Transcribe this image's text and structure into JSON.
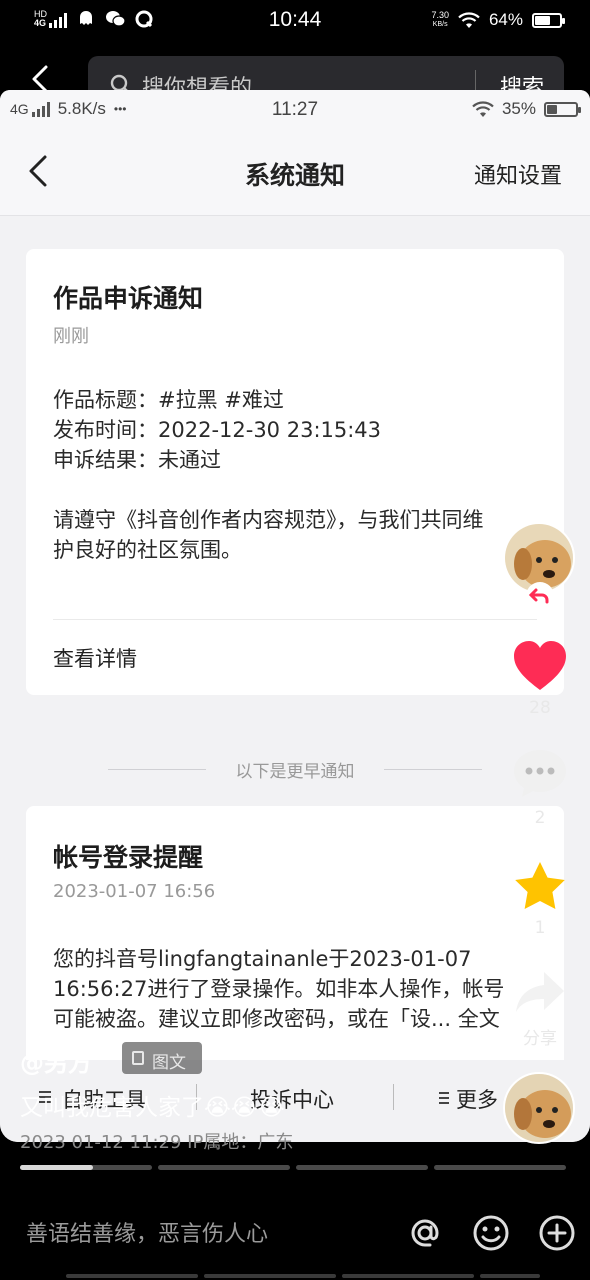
{
  "outer_status": {
    "network": "4G",
    "network_sup": "HD",
    "time": "10:44",
    "speed_top": "7.30",
    "speed_unit": "KB/s",
    "battery": "64%",
    "battery_level": 0.64
  },
  "outer_search": {
    "placeholder": "搜你想看的",
    "button": "搜索"
  },
  "inner_status": {
    "network": "4G",
    "speed": "5.8K/s",
    "dots": "•••",
    "time": "11:27",
    "battery": "35%",
    "battery_level": 0.35
  },
  "nav": {
    "title": "系统通知",
    "settings": "通知设置"
  },
  "notice1": {
    "title": "作品申诉通知",
    "time": "刚刚",
    "line1": "作品标题：#拉黑 #难过",
    "line2": "发布时间：2022-12-30 23:15:43",
    "line3": "申诉结果：未通过",
    "para1": "请遵守《抖音创作者内容规范》，与我们共同维",
    "para2": "护良好的社区氛围。",
    "more": "查看详情"
  },
  "earlier_divider": "以下是更早通知",
  "notice2": {
    "title": "帐号登录提醒",
    "time": "2023-01-07 16:56",
    "line1": "您的抖音号lingfangtainanle于2023-01-07",
    "line2": "16:56:27进行了登录操作。如非本人操作，帐号",
    "line3": "可能被盗。建议立即修改密码，或在「设... 全文"
  },
  "toolbar": {
    "item1": "自助工具",
    "item2": "投诉中心",
    "item3": "更多"
  },
  "video": {
    "author": "@另方",
    "tag": "图文",
    "caption": "又叫我危害人家了😭😭😭",
    "meta": "2023 01-12 11:29 IP属地：广东",
    "likes": "28",
    "comments": "2",
    "favorites": "1",
    "share": "分享",
    "progress": [
      1.0,
      0.0,
      0.0,
      0.0
    ],
    "progress_first_fill": 0.55
  },
  "comment_bar": {
    "placeholder": "善语结善缘，恶言伤人心"
  },
  "colors": {
    "like": "#fe2c55",
    "star": "#ffc300",
    "panel_bg": "#f2f2f4"
  }
}
